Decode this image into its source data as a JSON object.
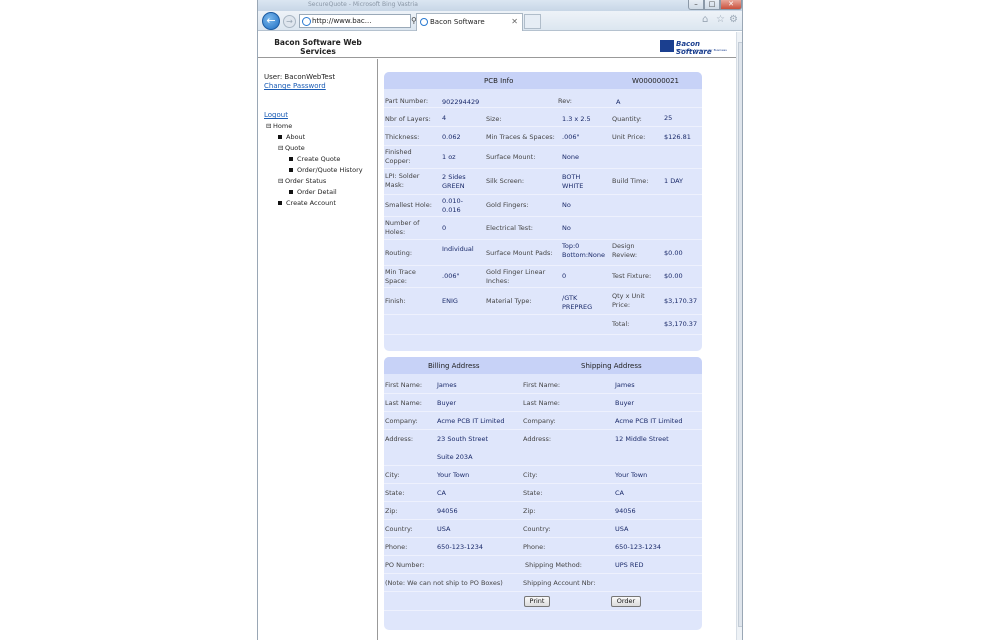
{
  "browser": {
    "title": "SecureQuote - Microsoft Bing Vastria",
    "address": "http://www.bac...",
    "tab_label": "Bacon Software"
  },
  "header": {
    "site_title": "Bacon Software Web Services",
    "logo_text": "Bacon Software",
    "logo_tagline": "Technology Solutions for Business"
  },
  "sidebar": {
    "user_label": "User: BaconWebTest",
    "change_password": "Change Password",
    "logout": "Logout",
    "tree": {
      "home": "Home",
      "about": "About",
      "quote": "Quote",
      "create_quote": "Create Quote",
      "order_history": "Order/Quote History",
      "order_status": "Order Status",
      "order_detail": "Order Detail",
      "create_account": "Create Account"
    }
  },
  "pcb": {
    "title": "PCB Info",
    "work_order": "W000000021",
    "part_number_label": "Part Number:",
    "part_number": "902294429",
    "rev_label": "Rev:",
    "rev": "A",
    "layers_label": "Nbr of Layers:",
    "layers": "4",
    "size_label": "Size:",
    "size": "1.3 x 2.5",
    "quantity_label": "Quantity:",
    "quantity": "25",
    "thickness_label": "Thickness:",
    "thickness": "0.062",
    "min_traces_label": "Min Traces & Spaces:",
    "min_traces": ".006\"",
    "unit_price_label": "Unit Price:",
    "unit_price": "$126.81",
    "finished_copper_label": "Finished Copper:",
    "finished_copper": "1 oz",
    "surface_mount_label": "Surface Mount:",
    "surface_mount": "None",
    "lpi_label": "LPI: Solder Mask:",
    "lpi_value": "2 Sides GREEN",
    "silk_screen_label": "Silk Screen:",
    "silk_screen": "BOTH WHITE",
    "build_time_label": "Build Time:",
    "build_time": "1 DAY",
    "smallest_hole_label": "Smallest Hole:",
    "smallest_hole": "0.010-0.016",
    "gold_fingers_label": "Gold Fingers:",
    "gold_fingers": "No",
    "num_holes_label": "Number of Holes:",
    "num_holes": "0",
    "electrical_test_label": "Electrical Test:",
    "electrical_test": "No",
    "routing_label": "Routing:",
    "routing": "Individual",
    "smt_pads_label": "Surface Mount Pads:",
    "smt_pads": "Top:0 Bottom:None",
    "design_review_label": "Design Review:",
    "design_review": "$0.00",
    "min_trace_space_label": "Min Trace Space:",
    "min_trace_space": ".006\"",
    "gold_finger_linear_label": "Gold Finger Linear Inches:",
    "gold_finger_linear": "0",
    "test_fixture_label": "Test Fixture:",
    "test_fixture": "$0.00",
    "finish_label": "Finish:",
    "finish": "ENIG",
    "material_label": "Material Type:",
    "material": "/GTK PREPREG",
    "qty_unit_label": "Qty x Unit Price:",
    "qty_unit": "$3,170.37",
    "total_label": "Total:",
    "total": "$3,170.37"
  },
  "address": {
    "billing_title": "Billing Address",
    "shipping_title": "Shipping Address",
    "first_name_label": "First Name:",
    "last_name_label": "Last Name:",
    "company_label": "Company:",
    "address_label": "Address:",
    "city_label": "City:",
    "state_label": "State:",
    "zip_label": "Zip:",
    "country_label": "Country:",
    "phone_label": "Phone:",
    "billing": {
      "first_name": "James",
      "last_name": "Buyer",
      "company": "Acme PCB IT Limited",
      "address1": "23 South Street",
      "address2": "Suite 203A",
      "city": "Your Town",
      "state": "CA",
      "zip": "94056",
      "country": "USA",
      "phone": "650-123-1234"
    },
    "shipping": {
      "first_name": "James",
      "last_name": "Buyer",
      "company": "Acme PCB IT Limited",
      "address1": "12 Middle Street",
      "city": "Your Town",
      "state": "CA",
      "zip": "94056",
      "country": "USA",
      "phone": "650-123-1234"
    },
    "po_number_label": "PO Number:",
    "shipping_method_label": "Shipping Method:",
    "shipping_method": "UPS RED",
    "po_note": "(Note: We can not ship to PO Boxes)",
    "shipping_account_label": "Shipping Account Nbr:",
    "print_button": "Print",
    "order_button": "Order"
  }
}
